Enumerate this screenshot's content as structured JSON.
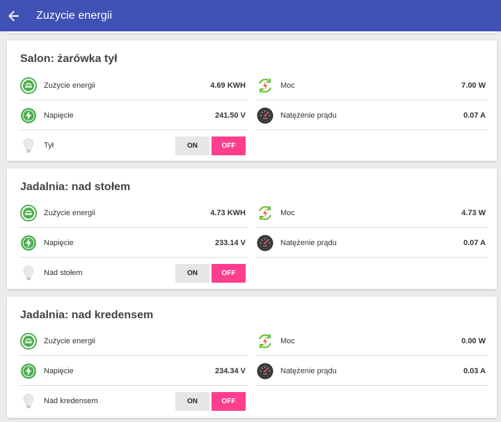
{
  "app_bar": {
    "title": "Zuzycie energii"
  },
  "devices": [
    {
      "name": "Salon: żarówka tył",
      "energy_label": "Zużycie energii",
      "energy_value": "4.69 KWH",
      "power_label": "Moc",
      "power_value": "7.00 W",
      "voltage_label": "Napięcie",
      "voltage_value": "241.50 V",
      "current_label": "Natężenie prądu",
      "current_value": "0.07 A",
      "switch_label": "Tył",
      "on_label": "ON",
      "off_label": "OFF"
    },
    {
      "name": "Jadalnia: nad stołem",
      "energy_label": "Zużycie energii",
      "energy_value": "4.73 KWH",
      "power_label": "Moc",
      "power_value": "4.73 W",
      "voltage_label": "Napięcie",
      "voltage_value": "233.14 V",
      "current_label": "Natężenie prądu",
      "current_value": "0.07 A",
      "switch_label": "Nad stołem",
      "on_label": "ON",
      "off_label": "OFF"
    },
    {
      "name": "Jadalnia: nad kredensem",
      "energy_label": "Zużycie energii",
      "energy_value": "",
      "power_label": "Moc",
      "power_value": "0.00 W",
      "voltage_label": "Napięcie",
      "voltage_value": "234.34 V",
      "current_label": "Natężenie prądu",
      "current_value": "0.03 A",
      "switch_label": "Nad kredensem",
      "on_label": "ON",
      "off_label": "OFF"
    }
  ],
  "icons": {
    "back": "arrow-left-icon",
    "energy": "energy-meter-icon",
    "power": "power-recycle-icon",
    "voltage": "lightning-bolt-icon",
    "current": "gauge-icon",
    "bulb": "lightbulb-icon"
  },
  "colors": {
    "app_bar": "#3f51b5",
    "off_active": "#ff3f8e",
    "icon_green": "#4caf50"
  }
}
